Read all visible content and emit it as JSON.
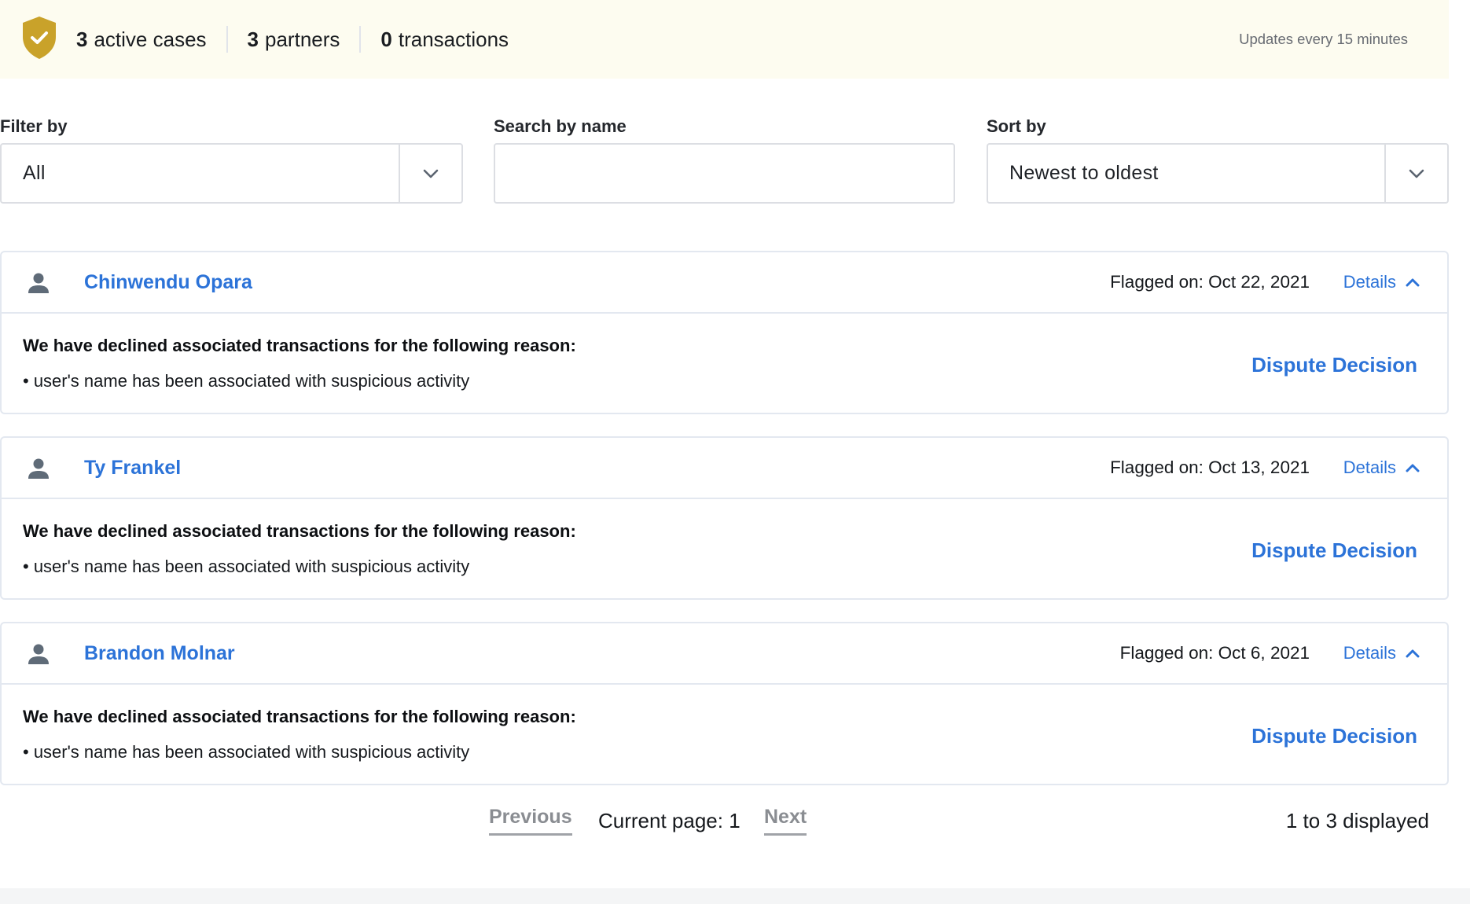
{
  "banner": {
    "icon": "shield-check-icon",
    "stats": [
      {
        "count": "3",
        "label": "active cases"
      },
      {
        "count": "3",
        "label": "partners"
      },
      {
        "count": "0",
        "label": "transactions"
      }
    ],
    "updates_text": "Updates every 15 minutes"
  },
  "filters": {
    "filter_by": {
      "label": "Filter by",
      "value": "All"
    },
    "search": {
      "label": "Search by name",
      "value": "",
      "placeholder": ""
    },
    "sort_by": {
      "label": "Sort by",
      "value": "Newest to oldest"
    }
  },
  "cases": [
    {
      "name": "Chinwendu Opara",
      "flagged": "Flagged on: Oct 22, 2021",
      "details_label": "Details",
      "reason_title": "We have declined associated transactions for the following reason:",
      "reason": "• user's name has been associated with suspicious activity",
      "action": "Dispute Decision"
    },
    {
      "name": "Ty Frankel",
      "flagged": "Flagged on: Oct 13, 2021",
      "details_label": "Details",
      "reason_title": "We have declined associated transactions for the following reason:",
      "reason": "• user's name has been associated with suspicious activity",
      "action": "Dispute Decision"
    },
    {
      "name": "Brandon Molnar",
      "flagged": "Flagged on: Oct 6, 2021",
      "details_label": "Details",
      "reason_title": "We have declined associated transactions for the following reason:",
      "reason": "• user's name has been associated with suspicious activity",
      "action": "Dispute Decision"
    }
  ],
  "pagination": {
    "previous": "Previous",
    "current": "Current page: 1",
    "next": "Next",
    "displayed": "1 to 3 displayed"
  },
  "colors": {
    "accent": "#2c73d8",
    "banner_bg": "#fdfcf0",
    "shield": "#c9a22a",
    "muted": "#8a8d92"
  }
}
